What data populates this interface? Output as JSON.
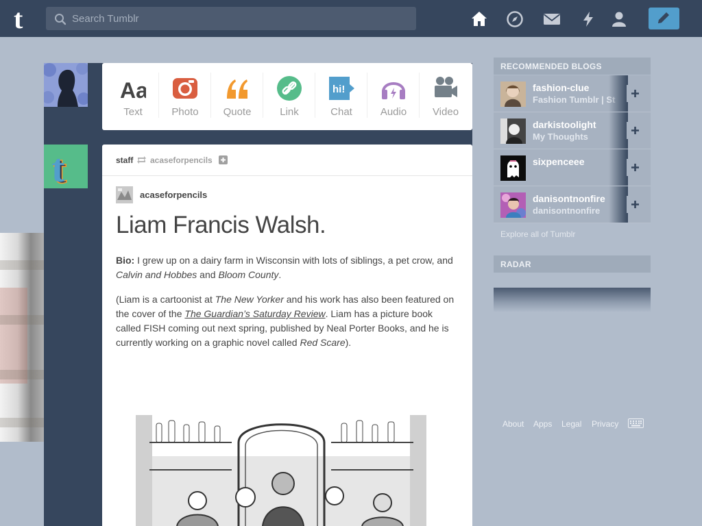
{
  "topbar": {
    "search_placeholder": "Search Tumblr",
    "colors": {
      "bar": "#36465d",
      "compose": "#529ecc"
    }
  },
  "post_types": [
    {
      "label": "Text",
      "icon": "text-icon",
      "color": "#444444"
    },
    {
      "label": "Photo",
      "icon": "camera-icon",
      "color": "#d95e40"
    },
    {
      "label": "Quote",
      "icon": "quote-icon",
      "color": "#f2992e"
    },
    {
      "label": "Link",
      "icon": "link-icon",
      "color": "#56bc8a"
    },
    {
      "label": "Chat",
      "icon": "chat-icon",
      "color": "#529ecc"
    },
    {
      "label": "Audio",
      "icon": "headphones-icon",
      "color": "#a77dc2"
    },
    {
      "label": "Video",
      "icon": "video-camera-icon",
      "color": "#748089"
    }
  ],
  "post": {
    "author": "staff",
    "reblogged_from": "acaseforpencils",
    "source_name": "acaseforpencils",
    "title": "Liam Francis Walsh.",
    "bio_label": "Bio:",
    "bio_text": " I grew up on a dairy farm in Wisconsin with lots of siblings, a pet crow, and ",
    "bio_italic1": "Calvin and Hobbes",
    "bio_and": " and ",
    "bio_italic2": "Bloom County",
    "bio_end": ".",
    "p2_a": "(Liam is a cartoonist at ",
    "p2_i1": "The New Yorker",
    "p2_b": " and his work has also been featured on the cover of the ",
    "p2_link": "The Guardian’s Saturday Review",
    "p2_c": ". Liam has a picture book called FISH coming out next spring, published by Neal Porter Books, and he is currently working on a graphic novel called ",
    "p2_i2": "Red Scare",
    "p2_d": ")."
  },
  "sidebar": {
    "recommended_heading": "RECOMMENDED BLOGS",
    "blogs": [
      {
        "name": "fashion-clue",
        "subtitle": "Fashion Tumblr | St"
      },
      {
        "name": "darkistoolight",
        "subtitle": "My Thoughts"
      },
      {
        "name": "sixpenceee",
        "subtitle": ""
      },
      {
        "name": "danisontnonfire",
        "subtitle": "danisontnonfire"
      }
    ],
    "explore": "Explore all of Tumblr",
    "radar_heading": "RADAR",
    "footer": [
      "About",
      "Apps",
      "Legal",
      "Privacy"
    ]
  }
}
